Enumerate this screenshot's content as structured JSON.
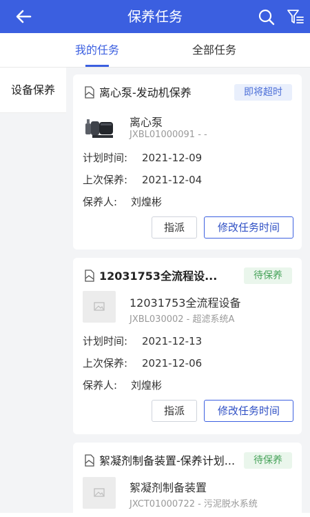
{
  "header": {
    "title": "保养任务",
    "back_icon": "arrow-left-icon",
    "search_icon": "search-icon",
    "filter_icon": "filter-icon"
  },
  "tabs": [
    {
      "label": "我的任务",
      "active": true
    },
    {
      "label": "全部任务",
      "active": false
    }
  ],
  "sidebar": {
    "items": [
      {
        "label": "设备保养"
      }
    ]
  },
  "labels": {
    "plan_time": "计划时间:",
    "last_maint": "上次保养:",
    "maintainer": "保养人:",
    "assign": "指派",
    "modify": "修改任务时间"
  },
  "cards": [
    {
      "title": "离心泵-发动机保养",
      "status": "即将超时",
      "equipment_name": "离心泵",
      "equipment_code": "JXBL01000091 - -",
      "plan_time": "2021-12-09",
      "last_maint": "2021-12-04",
      "maintainer": "刘煌彬"
    },
    {
      "title": "12031753全流程设...",
      "status": "待保养",
      "equipment_name": "12031753全流程设备",
      "equipment_code": "JXBL030002 - 超滤系统A",
      "plan_time": "2021-12-13",
      "last_maint": "2021-12-06",
      "maintainer": "刘煌彬"
    },
    {
      "title": "絮凝剂制备装置-保养计划...",
      "status": "待保养",
      "equipment_name": "絮凝剂制备装置",
      "equipment_code": "JXCT01000722 - 污泥脱水系统"
    }
  ],
  "colors": {
    "brand": "#3b5fe0",
    "badge_warn_bg": "#e9effc",
    "badge_pending_bg": "#eaf6ec",
    "badge_pending_text": "#47a35a"
  }
}
